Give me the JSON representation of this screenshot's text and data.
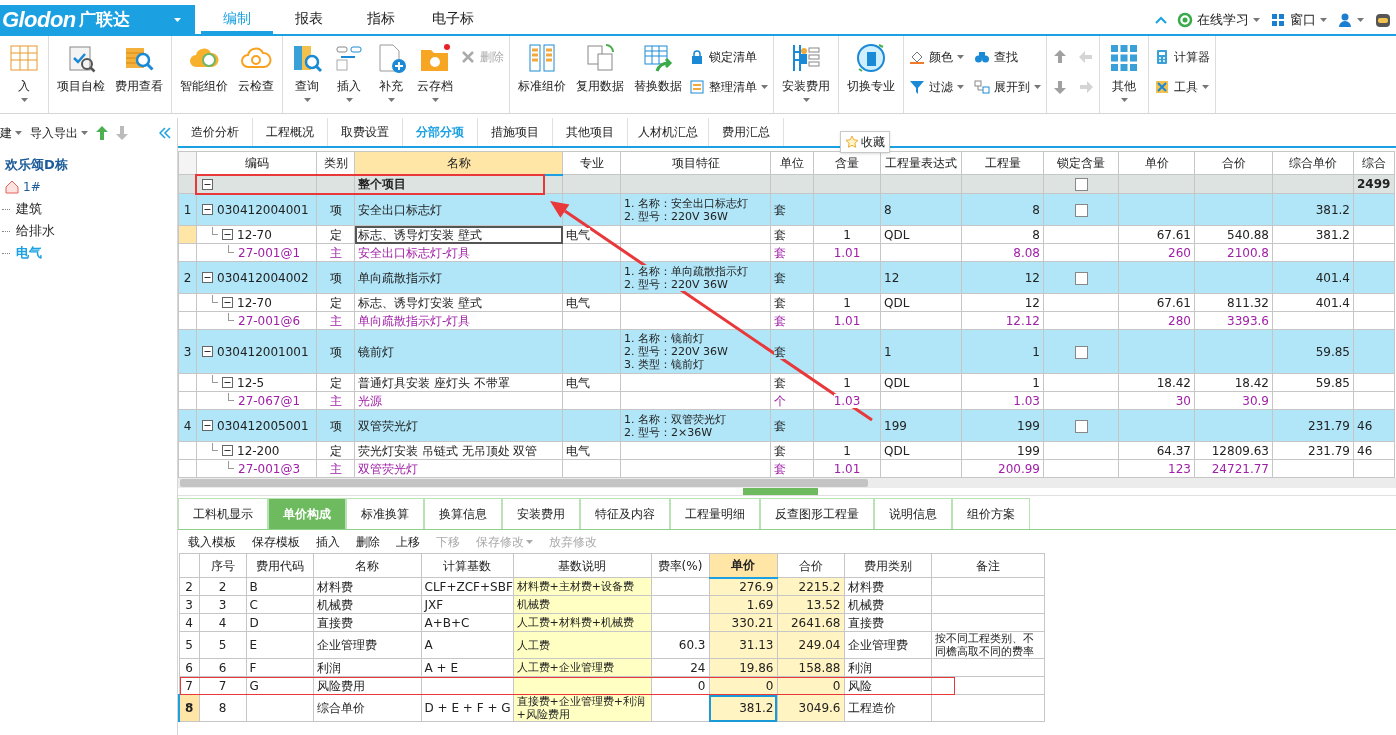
{
  "logo": {
    "brand": "Glodon",
    "name": "广联达"
  },
  "menu": [
    {
      "label": "编制",
      "selected": true
    },
    {
      "label": "报表",
      "selected": false
    },
    {
      "label": "指标",
      "selected": false
    },
    {
      "label": "电子标",
      "selected": false
    }
  ],
  "header_right": [
    {
      "label": "在线学习",
      "dropdown": true
    },
    {
      "label": "窗口",
      "dropdown": true
    }
  ],
  "ribbon": [
    {
      "items": [
        {
          "kind": "large",
          "label": "入",
          "dropdown": true,
          "disabled": false
        }
      ]
    },
    {
      "items": [
        {
          "kind": "large",
          "label": "项目自检",
          "dropdown": false,
          "disabled": false
        },
        {
          "kind": "large",
          "label": "费用查看",
          "dropdown": false,
          "disabled": false
        }
      ]
    },
    {
      "items": [
        {
          "kind": "large",
          "label": "智能组价",
          "dropdown": false,
          "disabled": false
        },
        {
          "kind": "large",
          "label": "云检查",
          "dropdown": false,
          "disabled": false
        }
      ]
    },
    {
      "items": [
        {
          "kind": "large",
          "label": "查询",
          "dropdown": true,
          "disabled": false
        },
        {
          "kind": "large",
          "label": "插入",
          "dropdown": true,
          "disabled": false
        },
        {
          "kind": "large",
          "label": "补充",
          "dropdown": true,
          "disabled": false
        },
        {
          "kind": "large",
          "label": "云存档",
          "dropdown": true,
          "disabled": false
        },
        {
          "kind": "small",
          "label": "删除",
          "dropdown": false,
          "disabled": true
        }
      ]
    },
    {
      "items": [
        {
          "kind": "large",
          "label": "标准组价",
          "dropdown": false,
          "disabled": false
        },
        {
          "kind": "large",
          "label": "复用数据",
          "dropdown": false,
          "disabled": false
        },
        {
          "kind": "large",
          "label": "替换数据",
          "dropdown": false,
          "disabled": false
        },
        {
          "kind": "small",
          "label": "锁定清单",
          "dropdown": false,
          "disabled": false
        },
        {
          "kind": "small",
          "label": "整理清单",
          "dropdown": true,
          "disabled": false
        }
      ]
    },
    {
      "items": [
        {
          "kind": "large",
          "label": "安装费用",
          "dropdown": true,
          "disabled": false
        }
      ]
    },
    {
      "items": [
        {
          "kind": "large",
          "label": "切换专业",
          "dropdown": false,
          "disabled": false
        }
      ]
    },
    {
      "items": [
        {
          "kind": "small",
          "label": "颜色",
          "dropdown": true,
          "disabled": false
        },
        {
          "kind": "small",
          "label": "过滤",
          "dropdown": true,
          "disabled": false
        },
        {
          "kind": "small",
          "label": "查找",
          "dropdown": false,
          "disabled": false
        },
        {
          "kind": "small",
          "label": "展开到",
          "dropdown": true,
          "disabled": false
        }
      ]
    },
    {
      "items": [
        {
          "kind": "arrow",
          "disabled": false
        },
        {
          "kind": "arrow",
          "disabled": false
        },
        {
          "kind": "arrow",
          "disabled": true
        },
        {
          "kind": "arrow",
          "disabled": true
        }
      ]
    },
    {
      "items": [
        {
          "kind": "large",
          "label": "其他",
          "dropdown": true,
          "disabled": false
        }
      ]
    },
    {
      "items": [
        {
          "kind": "small",
          "label": "计算器",
          "dropdown": false,
          "disabled": false
        },
        {
          "kind": "small",
          "label": "工具",
          "dropdown": true,
          "disabled": false
        }
      ]
    }
  ],
  "left_toolbar": [
    {
      "label": "建",
      "dropdown": true
    },
    {
      "label": "导入导出",
      "dropdown": true
    }
  ],
  "tree": [
    {
      "label": "欢乐颂D栋",
      "selected": false,
      "children": [
        {
          "label": "1#",
          "selected": false,
          "children": [
            {
              "label": "建筑",
              "selected": false
            },
            {
              "label": "给排水",
              "selected": false
            },
            {
              "label": "电气",
              "selected": true
            }
          ]
        }
      ]
    }
  ],
  "tabs": [
    {
      "label": "造价分析",
      "selected": false
    },
    {
      "label": "工程概况",
      "selected": false
    },
    {
      "label": "取费设置",
      "selected": false
    },
    {
      "label": "分部分项",
      "selected": true
    },
    {
      "label": "措施项目",
      "selected": false
    },
    {
      "label": "其他项目",
      "selected": false
    },
    {
      "label": "人材机汇总",
      "selected": false
    },
    {
      "label": "费用汇总",
      "selected": false
    }
  ],
  "grid": {
    "columns": [
      {
        "label": "编码",
        "selected": false
      },
      {
        "label": "类别",
        "selected": false
      },
      {
        "label": "名称",
        "selected": true
      },
      {
        "label": "专业",
        "selected": false
      },
      {
        "label": "项目特征",
        "selected": false
      },
      {
        "label": "单位",
        "selected": false
      },
      {
        "label": "含量",
        "selected": false
      },
      {
        "label": "工程量表达式",
        "selected": false
      },
      {
        "label": "工程量",
        "selected": false
      },
      {
        "label": "锁定含量",
        "selected": false
      },
      {
        "label": "单价",
        "selected": false
      },
      {
        "label": "合价",
        "selected": false
      },
      {
        "label": "综合单价",
        "selected": false
      },
      {
        "label": "综合",
        "selected": false
      }
    ],
    "rows": [
      {
        "kind": "total",
        "expanded": true,
        "name": "整个项目",
        "locked": false,
        "sum": "2499",
        "selected": false
      },
      {
        "kind": "item",
        "number": "1",
        "expanded": true,
        "code": "030412004001",
        "type": "项",
        "name": "安全出口标志灯",
        "features": [
          "1. 名称：安全出口标志灯",
          "2. 型号：220V 36W"
        ],
        "unit": "套",
        "expr": "8",
        "qty": "8",
        "locked": false,
        "unit_price": "381.2",
        "selected": false
      },
      {
        "kind": "quota",
        "expanded": true,
        "code": "12-70",
        "type": "定",
        "name": "标志、诱导灯安装 壁式",
        "major": "电气",
        "unit": "套",
        "content": "1",
        "expr": "QDL",
        "qty": "8",
        "price": "67.61",
        "total": "540.88",
        "unit_price": "381.2",
        "selected": true
      },
      {
        "kind": "main",
        "code": "27-001@1",
        "type": "主",
        "name": "安全出口标志灯-灯具",
        "unit": "套",
        "content": "1.01",
        "qty": "8.08",
        "price": "260",
        "total": "2100.8",
        "selected": false
      },
      {
        "kind": "item",
        "number": "2",
        "expanded": true,
        "code": "030412004002",
        "type": "项",
        "name": "单向疏散指示灯",
        "features": [
          "1. 名称：单向疏散指示灯",
          "2. 型号：220V 36W"
        ],
        "unit": "套",
        "expr": "12",
        "qty": "12",
        "locked": false,
        "unit_price": "401.4",
        "selected": false
      },
      {
        "kind": "quota",
        "expanded": true,
        "code": "12-70",
        "type": "定",
        "name": "标志、诱导灯安装 壁式",
        "major": "电气",
        "unit": "套",
        "content": "1",
        "expr": "QDL",
        "qty": "12",
        "price": "67.61",
        "total": "811.32",
        "unit_price": "401.4",
        "selected": false
      },
      {
        "kind": "main",
        "code": "27-001@6",
        "type": "主",
        "name": "单向疏散指示灯-灯具",
        "unit": "套",
        "content": "1.01",
        "qty": "12.12",
        "price": "280",
        "total": "3393.6",
        "selected": false
      },
      {
        "kind": "item",
        "number": "3",
        "expanded": true,
        "code": "030412001001",
        "type": "项",
        "name": "镜前灯",
        "features": [
          "1. 名称：镜前灯",
          "2. 型号：220V 36W",
          "3. 类型：镜前灯"
        ],
        "unit": "套",
        "expr": "1",
        "qty": "1",
        "locked": false,
        "unit_price": "59.85",
        "selected": false
      },
      {
        "kind": "quota",
        "expanded": true,
        "code": "12-5",
        "type": "定",
        "name": "普通灯具安装 座灯头 不带罩",
        "major": "电气",
        "unit": "套",
        "content": "1",
        "expr": "QDL",
        "qty": "1",
        "price": "18.42",
        "total": "18.42",
        "unit_price": "59.85",
        "selected": false
      },
      {
        "kind": "main",
        "code": "27-067@1",
        "type": "主",
        "name": "光源",
        "unit": "个",
        "content": "1.03",
        "qty": "1.03",
        "price": "30",
        "total": "30.9",
        "selected": false
      },
      {
        "kind": "item",
        "number": "4",
        "expanded": true,
        "code": "030412005001",
        "type": "项",
        "name": "双管荧光灯",
        "features": [
          "1. 名称：双管荧光灯",
          "2. 型号：2×36W"
        ],
        "unit": "套",
        "expr": "199",
        "qty": "199",
        "locked": false,
        "unit_price": "231.79",
        "sum": "46",
        "selected": false
      },
      {
        "kind": "quota",
        "expanded": true,
        "code": "12-200",
        "type": "定",
        "name": "荧光灯安装 吊链式 无吊顶处 双管",
        "major": "电气",
        "unit": "套",
        "content": "1",
        "expr": "QDL",
        "qty": "199",
        "price": "64.37",
        "total": "12809.63",
        "unit_price": "231.79",
        "sum": "46",
        "selected": false
      },
      {
        "kind": "main",
        "code": "27-001@3",
        "type": "主",
        "name": "双管荧光灯",
        "unit": "套",
        "content": "1.01",
        "qty": "200.99",
        "price": "123",
        "total": "24721.77",
        "selected": false
      }
    ]
  },
  "tooltip": {
    "label": "收藏"
  },
  "bottom_tabs": [
    {
      "label": "工料机显示",
      "selected": false
    },
    {
      "label": "单价构成",
      "selected": true
    },
    {
      "label": "标准换算",
      "selected": false
    },
    {
      "label": "换算信息",
      "selected": false
    },
    {
      "label": "安装费用",
      "selected": false
    },
    {
      "label": "特征及内容",
      "selected": false
    },
    {
      "label": "工程量明细",
      "selected": false
    },
    {
      "label": "反查图形工程量",
      "selected": false
    },
    {
      "label": "说明信息",
      "selected": false
    },
    {
      "label": "组价方案",
      "selected": false
    }
  ],
  "bottom_toolbar": [
    {
      "label": "载入模板",
      "disabled": false,
      "dropdown": false
    },
    {
      "label": "保存模板",
      "disabled": false,
      "dropdown": false
    },
    {
      "label": "插入",
      "disabled": false,
      "dropdown": false
    },
    {
      "label": "删除",
      "disabled": false,
      "dropdown": false
    },
    {
      "label": "上移",
      "disabled": false,
      "dropdown": false
    },
    {
      "label": "下移",
      "disabled": true,
      "dropdown": false
    },
    {
      "label": "保存修改",
      "disabled": true,
      "dropdown": true
    },
    {
      "label": "放弃修改",
      "disabled": true,
      "dropdown": false
    }
  ],
  "fee_table": {
    "columns": [
      {
        "label": "序号",
        "selected": false
      },
      {
        "label": "费用代码",
        "selected": false
      },
      {
        "label": "名称",
        "selected": false
      },
      {
        "label": "计算基数",
        "selected": false
      },
      {
        "label": "基数说明",
        "selected": false
      },
      {
        "label": "费率(%)",
        "selected": false
      },
      {
        "label": "单价",
        "selected": true
      },
      {
        "label": "合价",
        "selected": false
      },
      {
        "label": "费用类别",
        "selected": false
      },
      {
        "label": "备注",
        "selected": false
      }
    ],
    "rows": [
      {
        "number": "2",
        "seq": "2",
        "code": "B",
        "name": "材料费",
        "base": "CLF+ZCF+SBF",
        "desc": "材料费+主材费+设备费",
        "price": "276.9",
        "total": "2215.2",
        "category": "材料费",
        "selected": false
      },
      {
        "number": "3",
        "seq": "3",
        "code": "C",
        "name": "机械费",
        "base": "JXF",
        "desc": "机械费",
        "price": "1.69",
        "total": "13.52",
        "category": "机械费",
        "selected": false
      },
      {
        "number": "4",
        "seq": "4",
        "code": "D",
        "name": "直接费",
        "base": "A+B+C",
        "desc": "人工费+材料费+机械费",
        "price": "330.21",
        "total": "2641.68",
        "category": "直接费",
        "selected": false
      },
      {
        "number": "5",
        "seq": "5",
        "code": "E",
        "name": "企业管理费",
        "base": "A",
        "desc": "人工费",
        "rate": "60.3",
        "price": "31.13",
        "total": "249.04",
        "category": "企业管理费",
        "note": "按不同工程类别、不同檐高取不同的费率",
        "selected": false
      },
      {
        "number": "6",
        "seq": "6",
        "code": "F",
        "name": "利润",
        "base": "A + E",
        "desc": "人工费+企业管理费",
        "rate": "24",
        "price": "19.86",
        "total": "158.88",
        "category": "利润",
        "selected": false
      },
      {
        "number": "7",
        "seq": "7",
        "code": "G",
        "name": "风险费用",
        "rate": "0",
        "price": "0",
        "total": "0",
        "category": "风险",
        "selected": false
      },
      {
        "number": "8",
        "seq": "8",
        "name": "综合单价",
        "base": "D + E + F + G",
        "desc": "直接费+企业管理费+利润+风险费用",
        "price": "381.2",
        "total": "3049.6",
        "category": "工程造价",
        "selected": true
      }
    ]
  }
}
